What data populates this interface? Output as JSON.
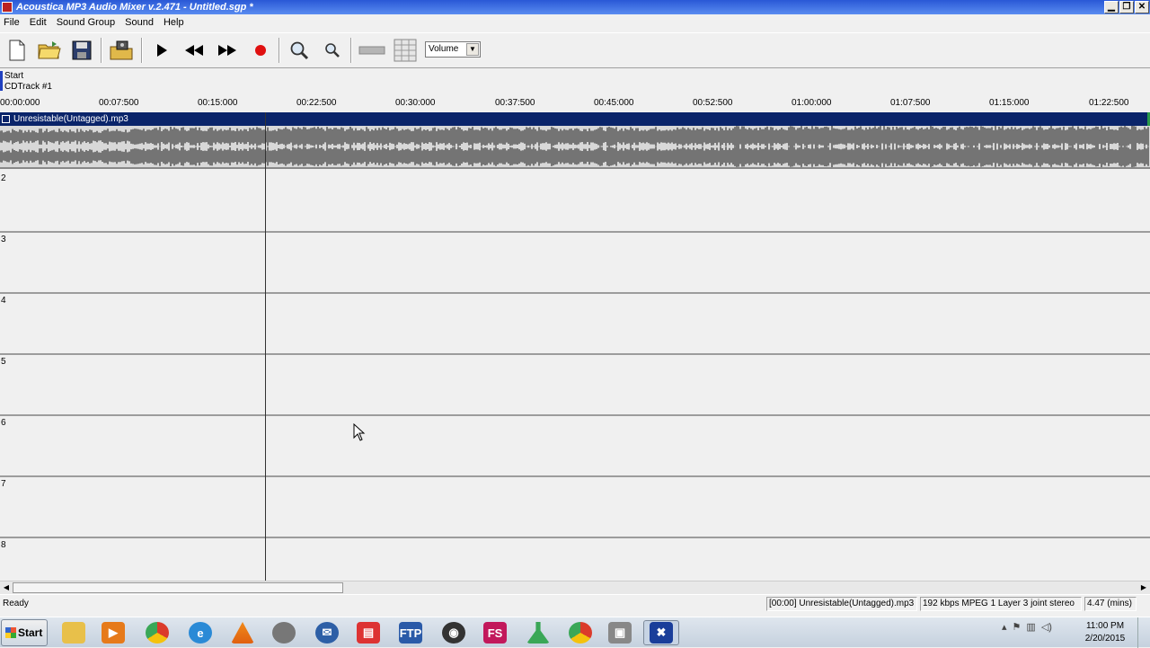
{
  "window": {
    "title": "Acoustica MP3 Audio Mixer v.2.471 - Untitled.sgp *",
    "buttons": {
      "minimize": "▁",
      "maximize": "❐",
      "close": "✕"
    }
  },
  "menu": [
    "File",
    "Edit",
    "Sound Group",
    "Sound",
    "Help"
  ],
  "toolbar": {
    "volume_select": "Volume",
    "icons": [
      "new-file-icon",
      "open-folder-icon",
      "save-icon",
      "import-icon",
      "play-icon",
      "rewind-icon",
      "fast-forward-icon",
      "record-icon",
      "zoom-in-icon",
      "zoom-out-icon",
      "slider-icon",
      "grid-icon"
    ]
  },
  "header": {
    "start_label": "Start",
    "cdtrack_label": "CDTrack #1"
  },
  "ruler": {
    "ticks": [
      "00:00:000",
      "00:07:500",
      "00:15:000",
      "00:22:500",
      "00:30:000",
      "00:37:500",
      "00:45:000",
      "00:52:500",
      "01:00:000",
      "01:07:500",
      "01:15:000",
      "01:22:500"
    ]
  },
  "track1": {
    "clip_name": "Unresistable(Untagged).mp3"
  },
  "tracks": [
    "2",
    "3",
    "4",
    "5",
    "6",
    "7",
    "8"
  ],
  "status": {
    "ready": "Ready",
    "clip": "[00:00] Unresistable(Untagged).mp3",
    "format": "192 kbps MPEG 1 Layer 3 joint stereo",
    "length": "4.47 (mins)"
  },
  "taskbar": {
    "start": "Start",
    "apps": [
      "explorer",
      "media-player",
      "chrome",
      "internet-explorer",
      "vlc",
      "film-editor",
      "thunderbird",
      "pdf-reader",
      "ftp",
      "eye-app",
      "fs-app",
      "lab-app",
      "chrome-2",
      "video-app",
      "acoustica"
    ],
    "app_labels": {
      "ftp": "FTP",
      "fs": "FS"
    },
    "time": "11:00 PM",
    "date": "2/20/2015",
    "colors": {
      "acoustica_active": "#1a3e9a"
    }
  }
}
